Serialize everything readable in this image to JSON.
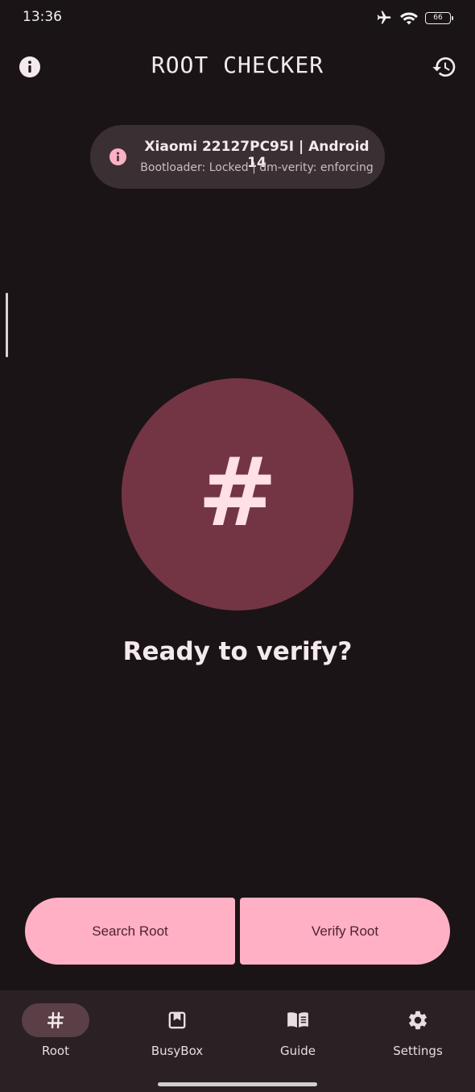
{
  "status_bar": {
    "time": "13:36",
    "battery": "66",
    "icons": [
      "airplane-icon",
      "wifi-icon",
      "battery-icon"
    ]
  },
  "top_bar": {
    "title": "ROOT CHECKER",
    "left_icon": "info-icon",
    "right_icon": "history-icon"
  },
  "device_card": {
    "icon": "info-icon",
    "name": "Xiaomi 22127PC95I | Android 14",
    "detail": "Bootloader: Locked | dm-verity: enforcing"
  },
  "main": {
    "hash_symbol": "#",
    "prompt": "Ready to verify?"
  },
  "actions": {
    "search_label": "Search Root",
    "verify_label": "Verify Root"
  },
  "bottom_nav": {
    "active": "Root",
    "items": [
      {
        "label": "Root",
        "icon": "hash-icon"
      },
      {
        "label": "BusyBox",
        "icon": "busybox-icon"
      },
      {
        "label": "Guide",
        "icon": "book-icon"
      },
      {
        "label": "Settings",
        "icon": "gear-icon"
      }
    ]
  },
  "colors": {
    "background": "#1b1416",
    "accent": "#ffb0c5",
    "circle": "#733544",
    "card": "#3a3033",
    "nav_background": "#2a2124",
    "nav_active": "#5b3f46"
  }
}
